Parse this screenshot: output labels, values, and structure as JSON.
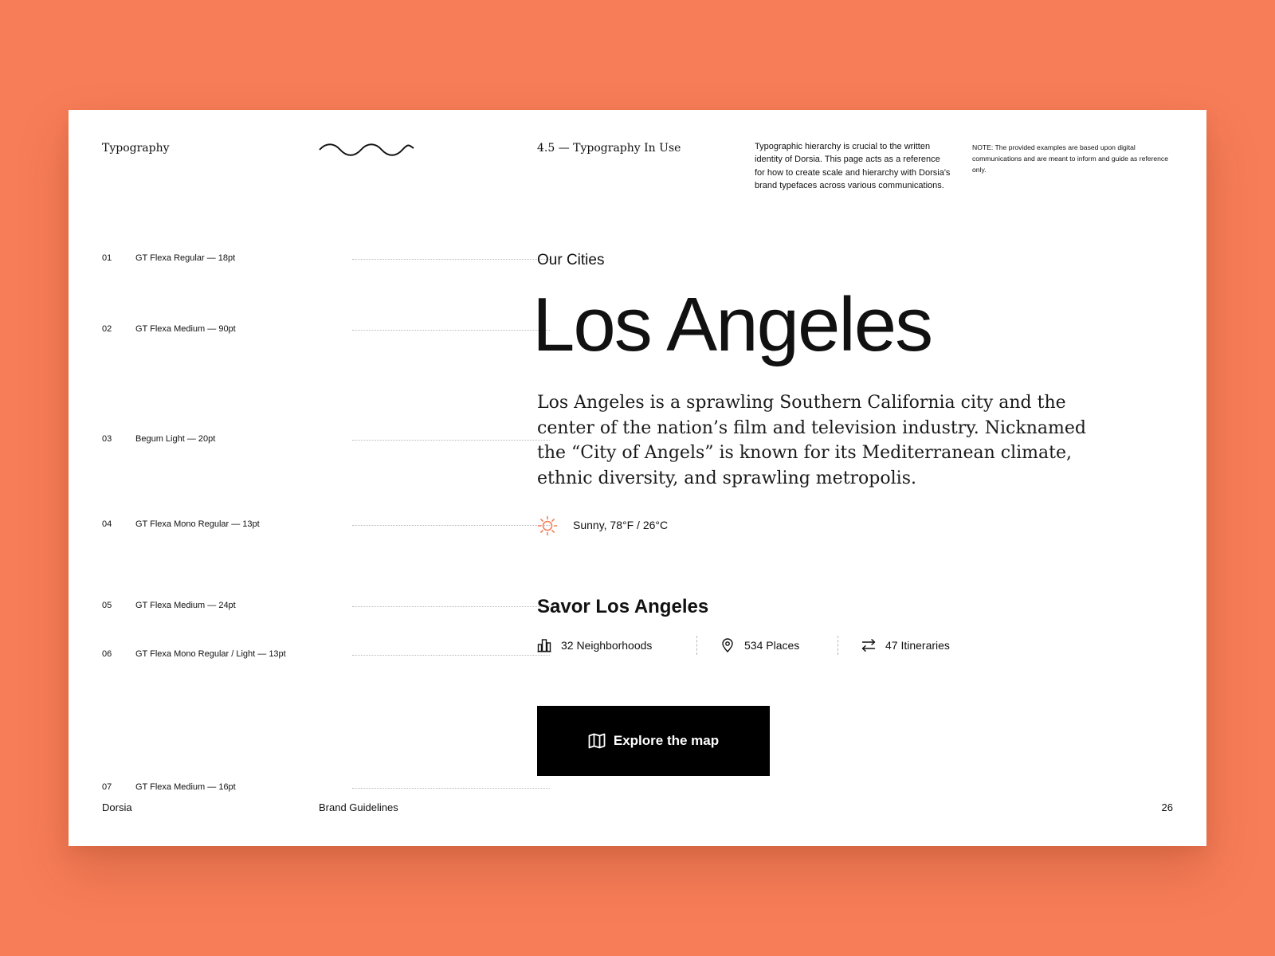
{
  "header": {
    "section_name": "Typography",
    "section_title": "4.5 — Typography In Use",
    "intro": "Typographic hierarchy is crucial to the written identity of Dorsia. This page acts as a reference for how to create scale and hierarchy with Dorsia's brand typefaces across various communications.",
    "note": "NOTE: The provided examples are based upon digital communications and are meant to inform and guide as reference only."
  },
  "specs": [
    {
      "num": "01",
      "label": "GT Flexa Regular — 18pt"
    },
    {
      "num": "02",
      "label": "GT Flexa Medium — 90pt"
    },
    {
      "num": "03",
      "label": "Begum Light — 20pt"
    },
    {
      "num": "04",
      "label": "GT Flexa Mono Regular — 13pt"
    },
    {
      "num": "05",
      "label": "GT Flexa Medium — 24pt"
    },
    {
      "num": "06",
      "label": "GT Flexa Mono Regular / Light — 13pt"
    },
    {
      "num": "07",
      "label": "GT Flexa Medium — 16pt"
    }
  ],
  "sample": {
    "kicker": "Our Cities",
    "headline": "Los Angeles",
    "body": "Los Angeles is a sprawling Southern California city and the center of the nation’s film and television industry. Nicknamed the “City of Angels” is known for its Mediterranean climate, ethnic diversity, and sprawling metropolis.",
    "weather": {
      "icon": "sun-icon",
      "text": "Sunny, 78°F / 26°C"
    },
    "subheading": "Savor Los Angeles",
    "stats": [
      {
        "icon": "buildings-icon",
        "text": "32 Neighborhoods"
      },
      {
        "icon": "location-pin-icon",
        "text": "534 Places"
      },
      {
        "icon": "route-icon",
        "text": "47 Itineraries"
      }
    ],
    "cta": {
      "icon": "map-icon",
      "label": "Explore the map"
    }
  },
  "footer": {
    "brand": "Dorsia",
    "document": "Brand Guidelines",
    "page_number": "26"
  },
  "colors": {
    "background": "#F77D58",
    "accent": "#F77D58",
    "page": "#FFFFFF",
    "button": "#000000"
  }
}
